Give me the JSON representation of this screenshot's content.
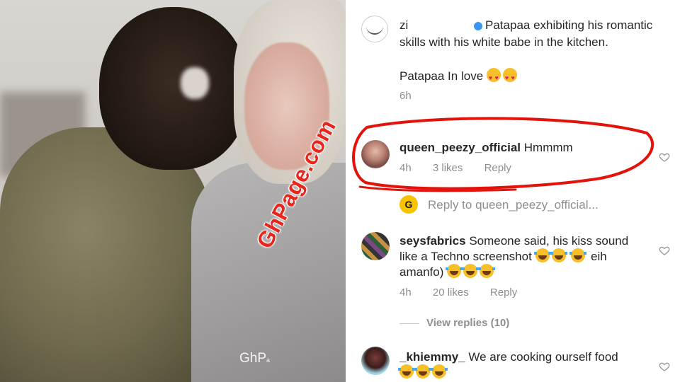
{
  "photo": {
    "watermark": "GhPage.com",
    "corner_tag": "GhP",
    "corner_tag_small": "a"
  },
  "caption": {
    "user_fragment": "zi",
    "text_line1": "Patapaa exhibiting",
    "text_rest": "his romantic skills with his white babe in the kitchen.",
    "text_2": "Patapaa In love",
    "time": "6h"
  },
  "comments": [
    {
      "username": "queen_peezy_official",
      "text": "Hmmmm",
      "time": "4h",
      "likes": "3 likes",
      "reply": "Reply"
    },
    {
      "username": "seysfabrics",
      "text_a": "Someone said, his kiss sound like a Techno screenshot",
      "text_b": "eih amanfo)",
      "time": "4h",
      "likes": "20 likes",
      "reply": "Reply"
    },
    {
      "username": "_khiemmy_",
      "text": "We are cooking ourself food"
    }
  ],
  "reply_composer": {
    "placeholder": "Reply to queen_peezy_official..."
  },
  "view_replies": "View replies (10)",
  "colors": {
    "annotation_red": "#e3120b",
    "meta_gray": "#8e8e8e",
    "watermark_red": "#e8261e"
  },
  "icons": [
    "like-heart-icon",
    "heart-eyes-emoji",
    "tears-of-joy-emoji",
    "verified-badge-icon"
  ]
}
